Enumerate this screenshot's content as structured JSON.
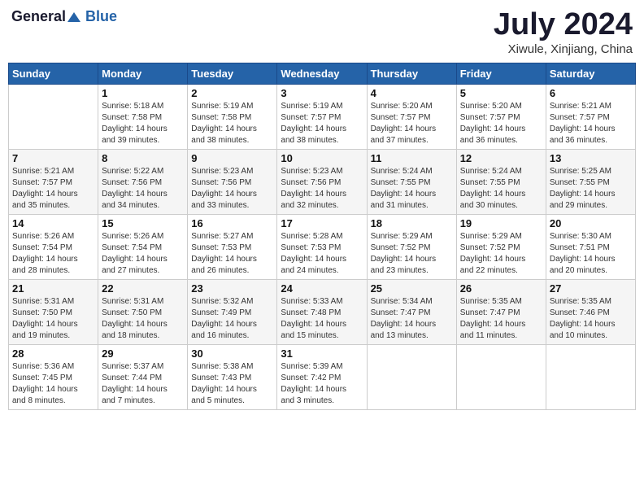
{
  "logo": {
    "general": "General",
    "blue": "Blue"
  },
  "title": "July 2024",
  "subtitle": "Xiwule, Xinjiang, China",
  "days_of_week": [
    "Sunday",
    "Monday",
    "Tuesday",
    "Wednesday",
    "Thursday",
    "Friday",
    "Saturday"
  ],
  "weeks": [
    [
      {
        "day": "",
        "info": ""
      },
      {
        "day": "1",
        "info": "Sunrise: 5:18 AM\nSunset: 7:58 PM\nDaylight: 14 hours\nand 39 minutes."
      },
      {
        "day": "2",
        "info": "Sunrise: 5:19 AM\nSunset: 7:58 PM\nDaylight: 14 hours\nand 38 minutes."
      },
      {
        "day": "3",
        "info": "Sunrise: 5:19 AM\nSunset: 7:57 PM\nDaylight: 14 hours\nand 38 minutes."
      },
      {
        "day": "4",
        "info": "Sunrise: 5:20 AM\nSunset: 7:57 PM\nDaylight: 14 hours\nand 37 minutes."
      },
      {
        "day": "5",
        "info": "Sunrise: 5:20 AM\nSunset: 7:57 PM\nDaylight: 14 hours\nand 36 minutes."
      },
      {
        "day": "6",
        "info": "Sunrise: 5:21 AM\nSunset: 7:57 PM\nDaylight: 14 hours\nand 36 minutes."
      }
    ],
    [
      {
        "day": "7",
        "info": "Sunrise: 5:21 AM\nSunset: 7:57 PM\nDaylight: 14 hours\nand 35 minutes."
      },
      {
        "day": "8",
        "info": "Sunrise: 5:22 AM\nSunset: 7:56 PM\nDaylight: 14 hours\nand 34 minutes."
      },
      {
        "day": "9",
        "info": "Sunrise: 5:23 AM\nSunset: 7:56 PM\nDaylight: 14 hours\nand 33 minutes."
      },
      {
        "day": "10",
        "info": "Sunrise: 5:23 AM\nSunset: 7:56 PM\nDaylight: 14 hours\nand 32 minutes."
      },
      {
        "day": "11",
        "info": "Sunrise: 5:24 AM\nSunset: 7:55 PM\nDaylight: 14 hours\nand 31 minutes."
      },
      {
        "day": "12",
        "info": "Sunrise: 5:24 AM\nSunset: 7:55 PM\nDaylight: 14 hours\nand 30 minutes."
      },
      {
        "day": "13",
        "info": "Sunrise: 5:25 AM\nSunset: 7:55 PM\nDaylight: 14 hours\nand 29 minutes."
      }
    ],
    [
      {
        "day": "14",
        "info": "Sunrise: 5:26 AM\nSunset: 7:54 PM\nDaylight: 14 hours\nand 28 minutes."
      },
      {
        "day": "15",
        "info": "Sunrise: 5:26 AM\nSunset: 7:54 PM\nDaylight: 14 hours\nand 27 minutes."
      },
      {
        "day": "16",
        "info": "Sunrise: 5:27 AM\nSunset: 7:53 PM\nDaylight: 14 hours\nand 26 minutes."
      },
      {
        "day": "17",
        "info": "Sunrise: 5:28 AM\nSunset: 7:53 PM\nDaylight: 14 hours\nand 24 minutes."
      },
      {
        "day": "18",
        "info": "Sunrise: 5:29 AM\nSunset: 7:52 PM\nDaylight: 14 hours\nand 23 minutes."
      },
      {
        "day": "19",
        "info": "Sunrise: 5:29 AM\nSunset: 7:52 PM\nDaylight: 14 hours\nand 22 minutes."
      },
      {
        "day": "20",
        "info": "Sunrise: 5:30 AM\nSunset: 7:51 PM\nDaylight: 14 hours\nand 20 minutes."
      }
    ],
    [
      {
        "day": "21",
        "info": "Sunrise: 5:31 AM\nSunset: 7:50 PM\nDaylight: 14 hours\nand 19 minutes."
      },
      {
        "day": "22",
        "info": "Sunrise: 5:31 AM\nSunset: 7:50 PM\nDaylight: 14 hours\nand 18 minutes."
      },
      {
        "day": "23",
        "info": "Sunrise: 5:32 AM\nSunset: 7:49 PM\nDaylight: 14 hours\nand 16 minutes."
      },
      {
        "day": "24",
        "info": "Sunrise: 5:33 AM\nSunset: 7:48 PM\nDaylight: 14 hours\nand 15 minutes."
      },
      {
        "day": "25",
        "info": "Sunrise: 5:34 AM\nSunset: 7:47 PM\nDaylight: 14 hours\nand 13 minutes."
      },
      {
        "day": "26",
        "info": "Sunrise: 5:35 AM\nSunset: 7:47 PM\nDaylight: 14 hours\nand 11 minutes."
      },
      {
        "day": "27",
        "info": "Sunrise: 5:35 AM\nSunset: 7:46 PM\nDaylight: 14 hours\nand 10 minutes."
      }
    ],
    [
      {
        "day": "28",
        "info": "Sunrise: 5:36 AM\nSunset: 7:45 PM\nDaylight: 14 hours\nand 8 minutes."
      },
      {
        "day": "29",
        "info": "Sunrise: 5:37 AM\nSunset: 7:44 PM\nDaylight: 14 hours\nand 7 minutes."
      },
      {
        "day": "30",
        "info": "Sunrise: 5:38 AM\nSunset: 7:43 PM\nDaylight: 14 hours\nand 5 minutes."
      },
      {
        "day": "31",
        "info": "Sunrise: 5:39 AM\nSunset: 7:42 PM\nDaylight: 14 hours\nand 3 minutes."
      },
      {
        "day": "",
        "info": ""
      },
      {
        "day": "",
        "info": ""
      },
      {
        "day": "",
        "info": ""
      }
    ]
  ]
}
